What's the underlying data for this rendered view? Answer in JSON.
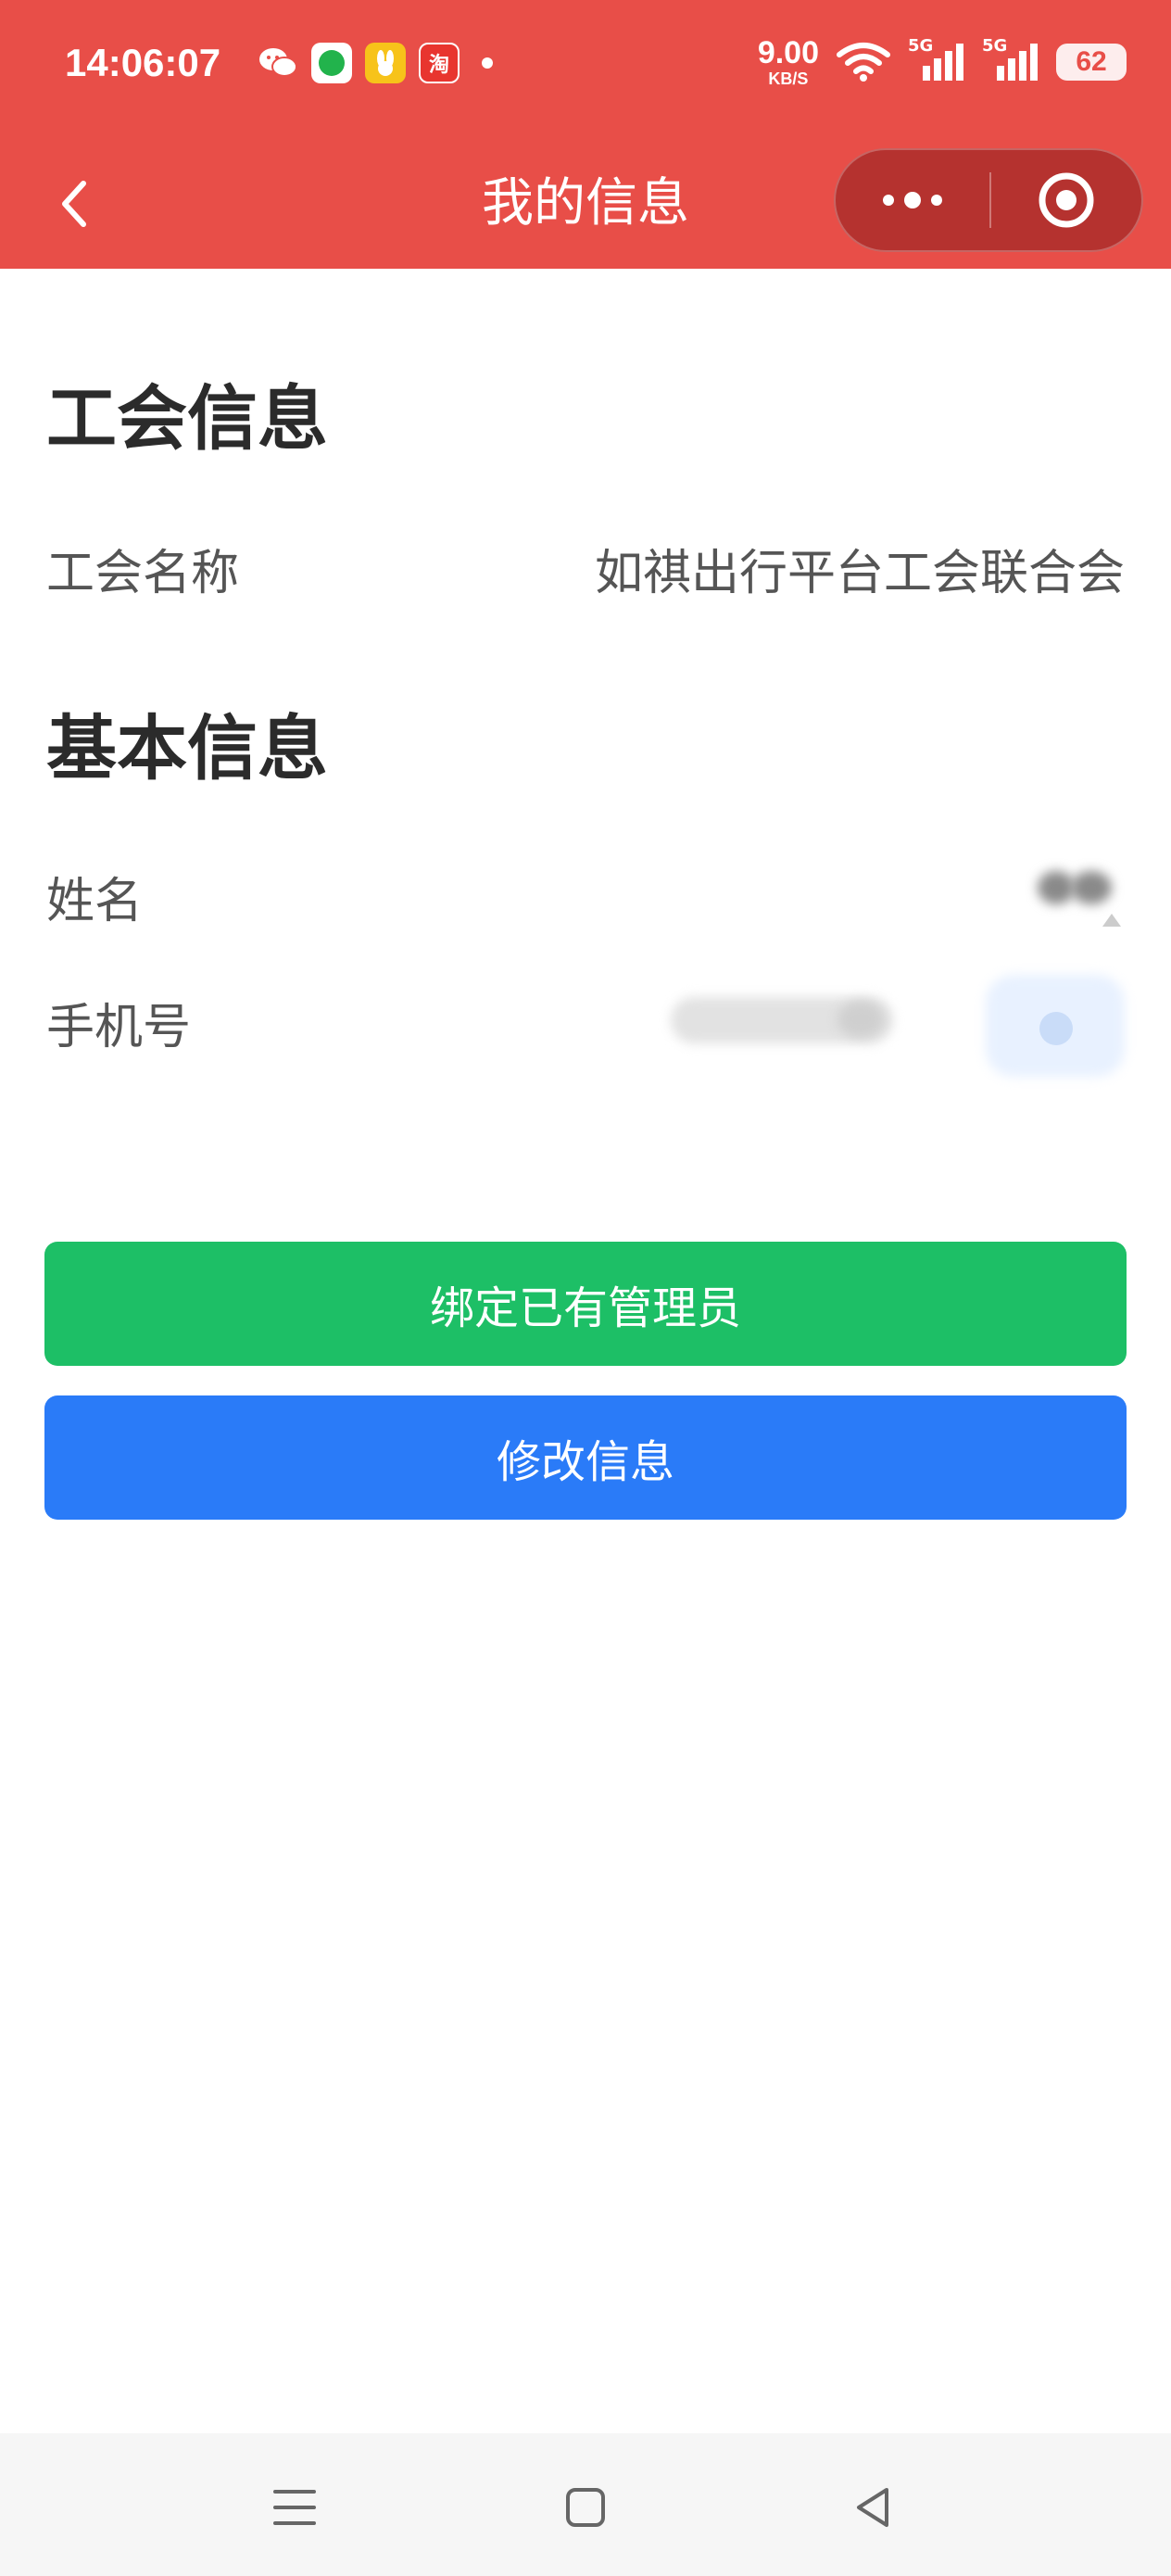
{
  "status_bar": {
    "time": "14:06:07",
    "net_speed": "9.00",
    "net_speed_unit": "KB/S",
    "signal1_label": "5G",
    "signal2_label": "5G",
    "battery": "62",
    "taobao_badge": "淘"
  },
  "nav": {
    "title": "我的信息"
  },
  "union_section": {
    "title": "工会信息",
    "name_label": "工会名称",
    "name_value": "如祺出行平台工会联合会"
  },
  "basic_section": {
    "title": "基本信息",
    "name_label": "姓名",
    "phone_label": "手机号"
  },
  "buttons": {
    "bind_admin": "绑定已有管理员",
    "edit_info": "修改信息"
  },
  "colors": {
    "header": "#e84e48",
    "green_button": "#1dbf66",
    "blue_button": "#2a7bf8"
  }
}
